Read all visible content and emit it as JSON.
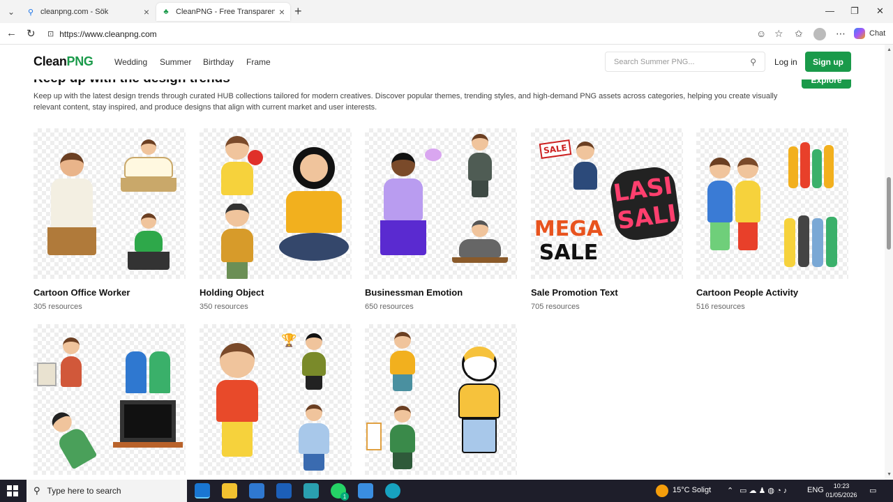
{
  "browser": {
    "tabs": [
      {
        "title": "cleanpng.com - Sök",
        "favicon": "search-icon"
      },
      {
        "title": "CleanPNG - Free Transparent PNG",
        "favicon": "leaf-icon"
      }
    ],
    "url": "https://www.cleanpng.com",
    "chat_label": "Chat"
  },
  "site": {
    "logo_main": "Clean",
    "logo_accent": "PNG",
    "nav": [
      "Wedding",
      "Summer",
      "Birthday",
      "Frame"
    ],
    "search_placeholder": "Search Summer PNG...",
    "login": "Log in",
    "signup": "Sign up"
  },
  "section": {
    "heading": "Keep up with the design trends",
    "explore": "Explore",
    "description": "Keep up with the latest design trends through curated HUB collections tailored for modern creatives. Discover popular themes, trending styles, and high-demand PNG assets across categories, helping you create visually relevant content, stay inspired, and produce designs that align with current market and user interests."
  },
  "collections": [
    {
      "title": "Cartoon Office Worker",
      "count": "305 resources"
    },
    {
      "title": "Holding Object",
      "count": "350 resources"
    },
    {
      "title": "Businessman Emotion",
      "count": "650 resources"
    },
    {
      "title": "Sale Promotion Text",
      "count": "705 resources"
    },
    {
      "title": "Cartoon People Activity",
      "count": "516 resources"
    },
    {
      "title": "",
      "count": ""
    },
    {
      "title": "",
      "count": ""
    },
    {
      "title": "",
      "count": ""
    }
  ],
  "sale_art": {
    "sale_sign": "SALE",
    "mega": "MEGA",
    "sale": "SALE",
    "flash": "LASI",
    "flash2": "SALI"
  },
  "taskbar": {
    "search_placeholder": "Type here to search",
    "weather": "15°C  Soligt",
    "language": "ENG",
    "time": "10:23",
    "date": "01/05/2026",
    "whatsapp_badge": "1"
  },
  "colors": {
    "accent": "#1a9a4a",
    "taskbar": "#1e1e2a"
  }
}
